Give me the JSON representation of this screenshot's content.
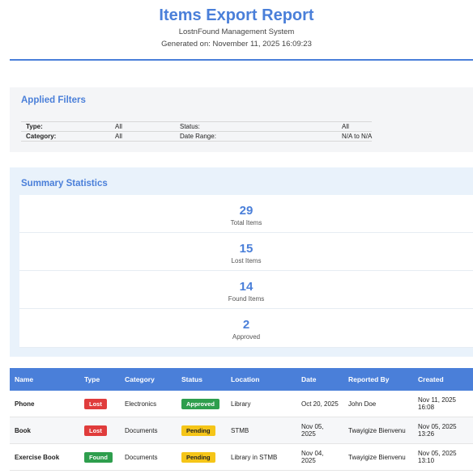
{
  "header": {
    "title": "Items Export Report",
    "subtitle": "LostnFound Management System",
    "generated": "Generated on: November 11, 2025 16:09:23"
  },
  "filters": {
    "heading": "Applied Filters",
    "rows": [
      {
        "label1": "Type:",
        "value1": "All",
        "label2": "Status:",
        "value2": "All"
      },
      {
        "label1": "Category:",
        "value1": "All",
        "label2": "Date Range:",
        "value2": "N/A to N/A"
      }
    ]
  },
  "summary": {
    "heading": "Summary Statistics",
    "stats": [
      {
        "value": "29",
        "label": "Total Items"
      },
      {
        "value": "15",
        "label": "Lost Items"
      },
      {
        "value": "14",
        "label": "Found Items"
      },
      {
        "value": "2",
        "label": "Approved"
      }
    ]
  },
  "table": {
    "columns": [
      "Name",
      "Type",
      "Category",
      "Status",
      "Location",
      "Date",
      "Reported By",
      "Created"
    ],
    "rows": [
      {
        "name": "Phone",
        "type": "Lost",
        "category": "Electronics",
        "status": "Approved",
        "location": "Library",
        "date": "Oct 20, 2025",
        "reported_by": "John Doe",
        "created": "Nov 11, 2025 16:08"
      },
      {
        "name": "Book",
        "type": "Lost",
        "category": "Documents",
        "status": "Pending",
        "location": "STMB",
        "date": "Nov 05, 2025",
        "reported_by": "Twayigize Bienvenu",
        "created": "Nov 05, 2025 13:26"
      },
      {
        "name": "Exercise Book",
        "type": "Found",
        "category": "Documents",
        "status": "Pending",
        "location": "Library in STMB",
        "date": "Nov 04, 2025",
        "reported_by": "Twayigize Bienvenu",
        "created": "Nov 05, 2025 13:10"
      }
    ]
  },
  "colors": {
    "accent": "#4a7fd9",
    "lost": "#e03c3c",
    "found": "#2e9e4d",
    "approved": "#2e9e4d",
    "pending": "#f5c518"
  }
}
